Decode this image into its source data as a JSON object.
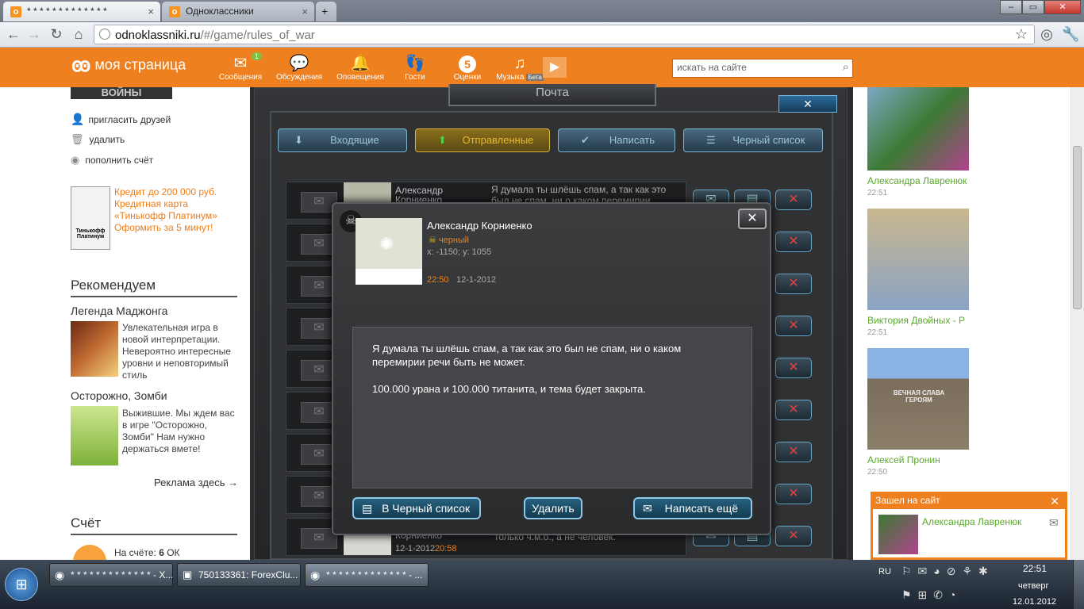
{
  "browser": {
    "tabs": [
      {
        "title": "* * * * * * * * * * * * *"
      },
      {
        "title": "Одноклассники"
      }
    ],
    "url_host": "odnoklassniki.ru",
    "url_path": "/#/game/rules_of_war"
  },
  "ok_header": {
    "logo": "моя страница",
    "nav": [
      {
        "label": "Сообщения",
        "badge": "1",
        "icon": "envelope-icon"
      },
      {
        "label": "Обсуждения",
        "icon": "chat-icon"
      },
      {
        "label": "Оповещения",
        "icon": "bell-icon"
      },
      {
        "label": "Гости",
        "icon": "footprints-icon"
      },
      {
        "label": "Оценки",
        "badge": "5",
        "icon": "rating-icon"
      },
      {
        "label": "Музыка",
        "beta": "Бета",
        "icon": "music-icon"
      }
    ],
    "search_placeholder": "искать на сайте"
  },
  "left": {
    "banner": "ВОЙНЫ",
    "links": [
      "пригласить друзей",
      "удалить",
      "пополнить счёт"
    ],
    "ad": {
      "logo": "Тинькофф Платинум",
      "text": "Кредит до 200 000 руб. Кредитная карта «Тинькофф Платинум» Оформить за 5 минут!"
    },
    "recommend_title": "Рекомендуем",
    "games": [
      {
        "title": "Легенда Маджонга",
        "desc": "Увлекательная игра в новой интерпретации. Невероятно интересные уровни и неповторимый стиль"
      },
      {
        "title": "Осторожно, Зомби",
        "desc": "Выжившие. Мы ждем вас в игре \"Осторожно, Зомби\" Нам нужно держаться вмете!"
      }
    ],
    "ads_here": "Реклама здесь →",
    "account_title": "Счёт",
    "balance_label": "На счёте:",
    "balance_value": "6",
    "balance_unit": "ОК"
  },
  "game": {
    "title": "Почта",
    "tabs": [
      "Входящие",
      "Отправленные",
      "Написать",
      "Черный список"
    ],
    "first_row": {
      "name": "Александр Корниенко",
      "preview": "Я думала ты шлёшь спам, а так как это был не спам, ни о каком перемирии"
    },
    "last_row": {
      "name": "Корниенко",
      "date": "12-1-2012",
      "time": "20:58",
      "preview": "только ч.м.о., а не человек."
    }
  },
  "modal": {
    "sender": "Александр Корниенко",
    "faction": "черный",
    "coords": "x: -1150; y: 1055",
    "time": "22:50",
    "date": "12-1-2012",
    "message_p1": "Я думала ты шлёшь спам, а так как это был не спам, ни о каком перемирии речи быть не может.",
    "message_p2": "100.000 урана и 100.000 титанита, и тема будет закрыта.",
    "btn_blacklist": "В Черный список",
    "btn_delete": "Удалить",
    "btn_write": "Написать ещё"
  },
  "right": {
    "friends": [
      {
        "name": "Александра Лавренюк",
        "time": "22:51"
      },
      {
        "name": "Виктория Двойных - Р",
        "time": "22:51"
      },
      {
        "name": "Алексей Пронин",
        "time": "22:50"
      }
    ],
    "photo_caption": "ВЕЧНАЯ СЛАВА ГЕРОЯМ",
    "notify_title": "Зашел на сайт",
    "notify_name": "Александра Лавренюк"
  },
  "taskbar": {
    "items": [
      "* * * * * * * * * * * * * - X...",
      "750133361: ForexClu...",
      "* * * * * * * * * * * * * - ..."
    ],
    "lang": "RU",
    "time": "22:51",
    "day": "четверг",
    "date": "12.01.2012"
  },
  "colors": {
    "ok_orange": "#ef8020",
    "link_green": "#5aa72d",
    "game_dark": "#2a2c2f"
  }
}
